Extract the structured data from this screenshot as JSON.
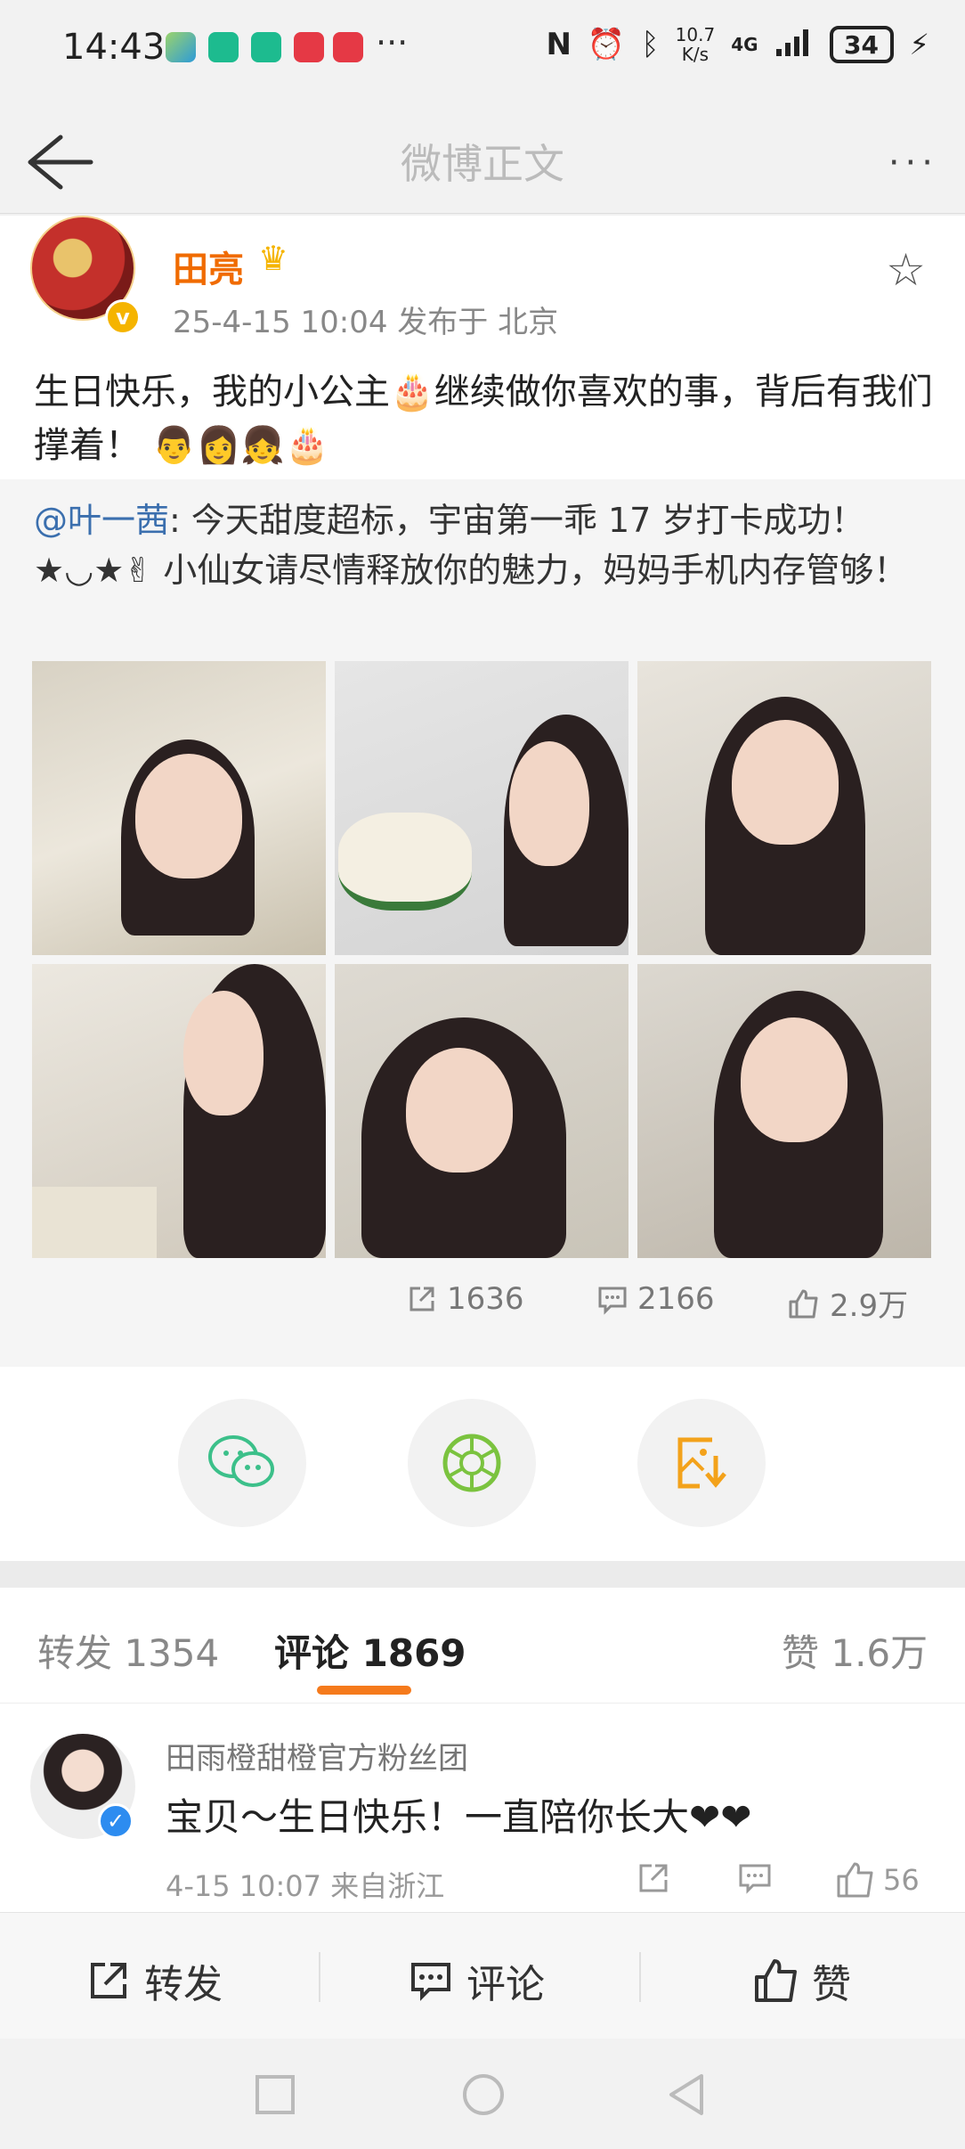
{
  "status": {
    "time": "14:43",
    "more": "···",
    "speed_top": "10.7",
    "speed_bottom": "K/s",
    "network": "4G",
    "battery": "34"
  },
  "nav": {
    "title": "微博正文",
    "more": "···"
  },
  "post": {
    "author": "田亮",
    "meta": "25-4-15 10:04  发布于 北京",
    "text": "生日快乐，我的小公主🎂继续做你喜欢的事，背后有我们撑着！ 👨👩👧🎂"
  },
  "repost": {
    "mention": "@叶一茜",
    "text": ": 今天甜度超标，宇宙第一乖 17 岁打卡成功！ ★◡★✌ 小仙女请尽情释放你的魅力，妈妈手机内存管够！",
    "stats": {
      "repost": "1636",
      "comment": "2166",
      "like": "2.9万"
    }
  },
  "share": {
    "items": [
      "wechat",
      "moments",
      "save-image"
    ]
  },
  "tabs": {
    "repost_label": "转发 1354",
    "comment_label": "评论 1869",
    "like_label": "赞 1.6万"
  },
  "comment": {
    "user": "田雨橙甜橙官方粉丝团",
    "text": "宝贝～生日快乐！一直陪你长大❤❤",
    "meta": "4-15 10:07  来自浙江",
    "likes": "56"
  },
  "bottom": {
    "repost": "转发",
    "comment": "评论",
    "like": "赞"
  },
  "colors": {
    "accent": "#f57a1c",
    "author": "#f06b00",
    "mention": "#3b6fae",
    "vip": "#f5b400",
    "verify_blue": "#2d8cf0"
  }
}
